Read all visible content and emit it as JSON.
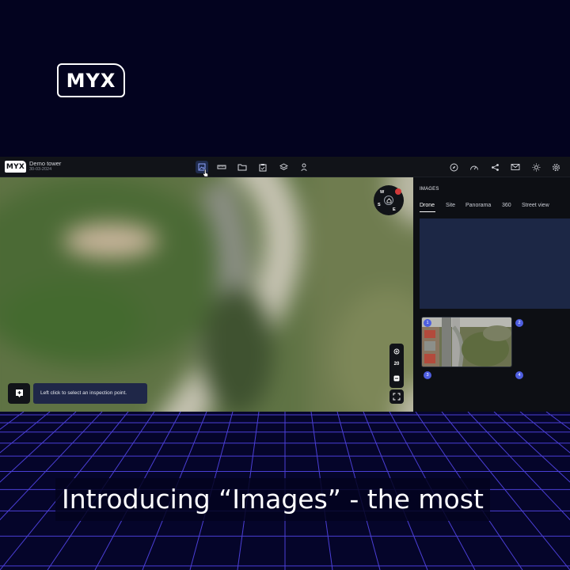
{
  "brand": {
    "logo_text": "MYX"
  },
  "caption": {
    "text": "Introducing “Images” - the most"
  },
  "app": {
    "logo_text": "MYX",
    "project_title": "Demo tower",
    "project_date": "30-03-2024",
    "toolbar_left": [
      {
        "icon": "image-icon",
        "active": true
      },
      {
        "icon": "ruler-icon"
      },
      {
        "icon": "folder-icon"
      },
      {
        "icon": "clipboard-check-icon"
      },
      {
        "icon": "layers-icon"
      },
      {
        "icon": "person-pin-icon"
      }
    ],
    "toolbar_right": [
      {
        "icon": "compass-icon"
      },
      {
        "icon": "gauge-icon"
      },
      {
        "icon": "share-icon"
      },
      {
        "icon": "mail-icon"
      },
      {
        "icon": "sun-icon"
      },
      {
        "icon": "gear-icon"
      }
    ]
  },
  "map": {
    "compass": {
      "w": "W",
      "s": "S",
      "e": "E"
    },
    "zoom_level": "20",
    "hint": "Left click to select an inspection point."
  },
  "panel": {
    "heading": "IMAGES",
    "tabs": [
      {
        "label": "Drone",
        "active": true
      },
      {
        "label": "Site"
      },
      {
        "label": "Panorama"
      },
      {
        "label": "360"
      },
      {
        "label": "Street view"
      }
    ],
    "thumbnails": [
      "1",
      "2",
      "3",
      "4"
    ]
  },
  "colors": {
    "background": "#03031f",
    "grid": "#4b3fd6",
    "accent": "#4e5ee0",
    "preview_fill": "#1c2745",
    "compass_north": "#d23a3a"
  }
}
